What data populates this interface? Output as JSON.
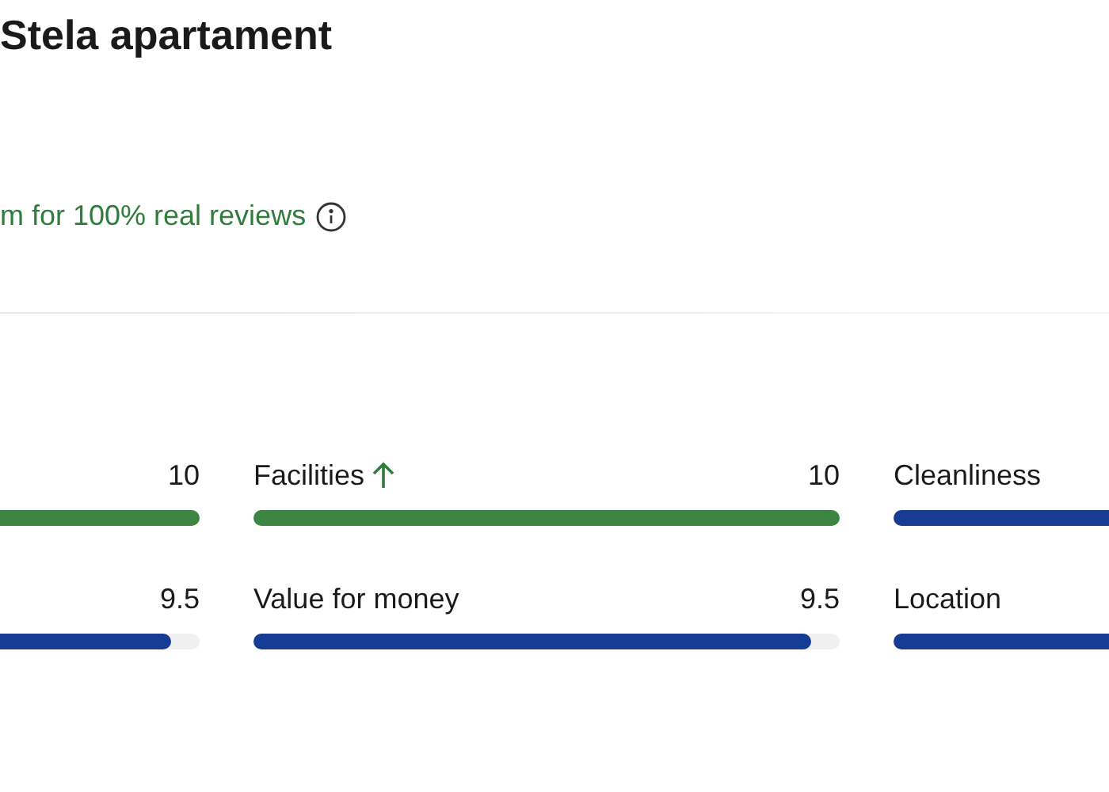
{
  "title": "Stela apartament",
  "subtitle": "m for 100% real reviews",
  "categories": [
    {
      "score": "10",
      "level": 1,
      "highlighted": true
    },
    {
      "label": "Facilities",
      "score": "10",
      "level": 1,
      "highlighted": true
    },
    {
      "label": "Cleanliness",
      "level": 1,
      "highlighted": false
    },
    {
      "score": "9.5",
      "level": 0.95,
      "highlighted": false
    },
    {
      "label": "Value for money",
      "score": "9.5",
      "level": 0.95,
      "highlighted": false
    },
    {
      "label": "Location",
      "level": 1,
      "highlighted": false
    }
  ]
}
